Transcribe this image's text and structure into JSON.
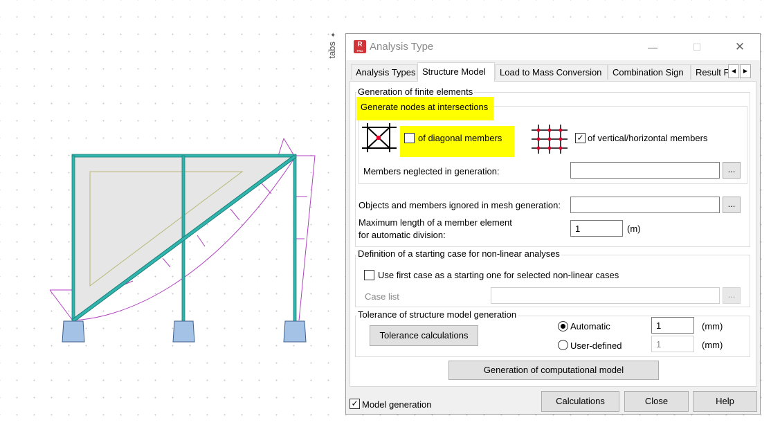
{
  "side_panel": {
    "label": "tabs"
  },
  "dialog": {
    "title": "Analysis Type",
    "app_icon": {
      "letter": "R",
      "sub": "PRO"
    },
    "tabs": [
      {
        "label": "Analysis Types"
      },
      {
        "label": "Structure Model"
      },
      {
        "label": "Load to Mass Conversion"
      },
      {
        "label": "Combination Sign"
      },
      {
        "label": "Result F"
      }
    ],
    "active_tab": "Structure Model",
    "fe_group": {
      "title": "Generation of finite elements",
      "nodes_title": "Generate nodes at intersections",
      "diagonal": {
        "label": "of diagonal members",
        "checked": false
      },
      "vertical": {
        "label": "of vertical/horizontal members",
        "checked": true
      },
      "neglected": {
        "label": "Members neglected in generation:",
        "value": ""
      },
      "ignored": {
        "label": "Objects and members ignored in mesh generation:",
        "value": ""
      },
      "max_length": {
        "label_line1": "Maximum length of a member element",
        "label_line2": "for automatic division:",
        "value": "1",
        "unit": "(m)"
      }
    },
    "nonlinear_group": {
      "title": "Definition of a starting case for non-linear analyses",
      "use_first": {
        "label": "Use first case as a starting one for selected non-linear cases",
        "checked": false
      },
      "case_list": {
        "label": "Case list",
        "value": ""
      }
    },
    "tolerance_group": {
      "title": "Tolerance of structure model generation",
      "calc_button": "Tolerance calculations",
      "automatic": {
        "label": "Automatic",
        "value": "1",
        "unit": "(mm)",
        "selected": true
      },
      "user_defined": {
        "label": "User-defined",
        "value": "1",
        "unit": "(mm)",
        "selected": false
      }
    },
    "generate_button": "Generation of computational model",
    "footer": {
      "model_generation": {
        "label": "Model generation",
        "checked": true
      },
      "calculations": "Calculations",
      "close": "Close",
      "help": "Help"
    },
    "browse_label": "..."
  },
  "colors": {
    "highlight": "#ffff00",
    "member": "#2fb5ad",
    "support": "#a4c2e6",
    "diagram": "#b040c0",
    "panel_fill": "#e6e6e6",
    "node_red": "#e0002a"
  }
}
